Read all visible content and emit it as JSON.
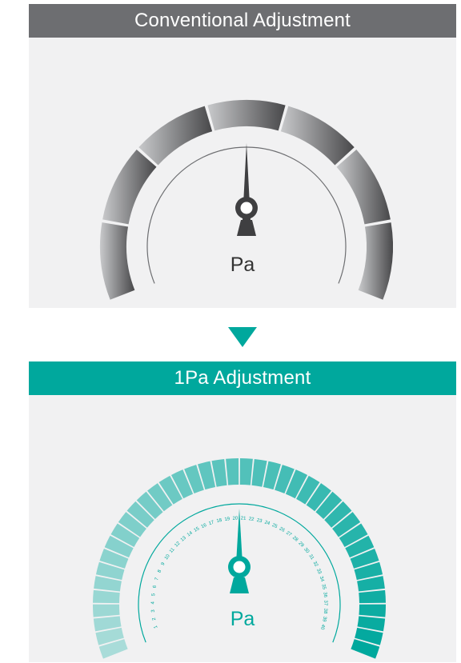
{
  "top": {
    "title": "Conventional Adjustment",
    "unit": "Pa",
    "colors": {
      "header": "#6d6e71",
      "gauge_start": "#c8c9cb",
      "gauge_end": "#4b4b4d",
      "needle": "#3f3f41"
    }
  },
  "bottom": {
    "title": "1Pa Adjustment",
    "unit": "Pa",
    "scale_labels": [
      "1",
      "2",
      "3",
      "4",
      "5",
      "6",
      "7",
      "8",
      "9",
      "10",
      "11",
      "12",
      "13",
      "14",
      "15",
      "16",
      "17",
      "18",
      "19",
      "20",
      "21",
      "22",
      "23",
      "24",
      "25",
      "26",
      "27",
      "28",
      "29",
      "30",
      "31",
      "32",
      "33",
      "34",
      "35",
      "36",
      "37",
      "38",
      "39",
      "40"
    ],
    "colors": {
      "header": "#00a89d",
      "gauge_start": "#a9dcd9",
      "gauge_end": "#00a89d",
      "needle": "#00a89d"
    }
  },
  "arrow": {
    "icon": "down-triangle-icon",
    "color": "#00a89d"
  }
}
